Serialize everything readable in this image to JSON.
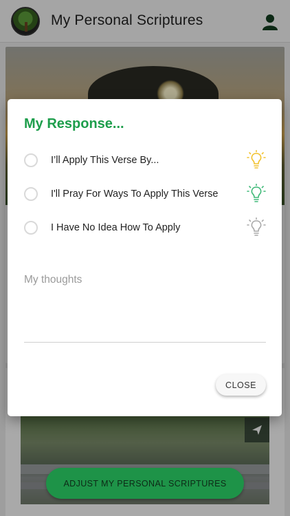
{
  "app": {
    "title": "My Personal Scriptures"
  },
  "dialog": {
    "title": "My Response...",
    "options": [
      {
        "label": "I’ll Apply This Verse By...",
        "icon": "lightbulb-yellow-icon",
        "color": "#f2c22e"
      },
      {
        "label": "I'll Pray For Ways To Apply This Verse",
        "icon": "lightbulb-green-icon",
        "color": "#3fb978"
      },
      {
        "label": "I Have No Idea How To Apply",
        "icon": "lightbulb-gray-icon",
        "color": "#a9a9a9"
      }
    ],
    "thoughts_placeholder": "My thoughts",
    "thoughts_value": "",
    "close_label": "CLOSE"
  },
  "footer": {
    "adjust_label": "ADJUST MY PERSONAL SCRIPTURES"
  },
  "colors": {
    "accent": "#1e9e4c",
    "button_green": "#1e9348"
  }
}
